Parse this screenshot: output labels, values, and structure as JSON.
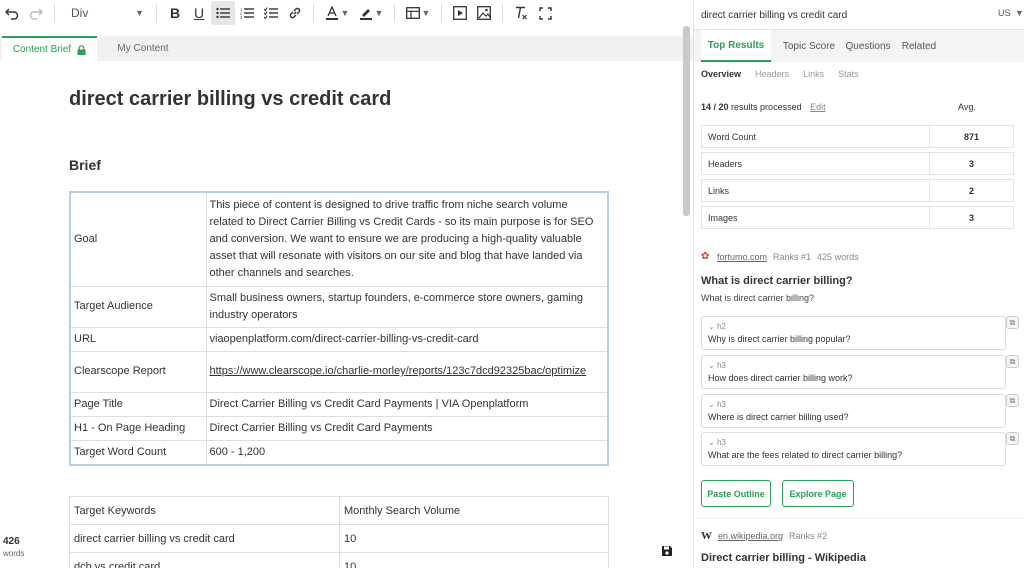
{
  "toolbar": {
    "block_type": "Div"
  },
  "editor": {
    "tabs": {
      "brief": "Content Brief",
      "content": "My Content"
    },
    "title": "direct carrier billing vs credit card",
    "brief_heading": "Brief",
    "brief_rows": [
      {
        "key": "Goal",
        "value": "This piece of content is designed to drive traffic from niche search volume related to Direct Carrier Billing vs Credit Cards - so its main purpose is for SEO and conversion. We want to ensure we are producing a high-quality valuable asset that will resonate with visitors on our site and blog that have landed via other channels and searches."
      },
      {
        "key": "Target Audience",
        "value": "Small business owners, startup founders, e-commerce store owners, gaming industry operators"
      },
      {
        "key": "URL",
        "value": "viaopenplatform.com/direct-carrier-billing-vs-credit-card"
      },
      {
        "key": "Clearscope Report",
        "value": "https://www.clearscope.io/charlie-morley/reports/123c7dcd92325bac/optimize"
      },
      {
        "key": "Page Title",
        "value": "Direct Carrier Billing vs Credit Card Payments | VIA Openplatform"
      },
      {
        "key": "H1 - On Page Heading",
        "value": "Direct Carrier Billing vs Credit Card Payments"
      },
      {
        "key": "Target Word Count",
        "value": "600 - 1,200"
      }
    ],
    "keywords": {
      "headers": [
        "Target Keywords",
        "Monthly Search Volume"
      ],
      "rows": [
        [
          "direct carrier billing vs credit card",
          "10"
        ],
        [
          "dcb vs credit card",
          "10"
        ]
      ]
    },
    "word_count": {
      "number": "426",
      "label": "words"
    }
  },
  "panel": {
    "search": {
      "value": "direct carrier billing vs credit card",
      "country": "US"
    },
    "tabs": [
      "Top Results",
      "Topic Score",
      "Questions",
      "Related"
    ],
    "subtabs": [
      "Overview",
      "Headers",
      "Links",
      "Stats"
    ],
    "processed": {
      "count": "14 / 20",
      "label": "results processed",
      "edit": "Edit"
    },
    "avg_label": "Avg.",
    "stats": [
      {
        "label": "Word Count",
        "value": "871"
      },
      {
        "label": "Headers",
        "value": "3"
      },
      {
        "label": "Links",
        "value": "2"
      },
      {
        "label": "Images",
        "value": "3"
      }
    ],
    "result1": {
      "domain": "fortumo.com",
      "rank": "Ranks #1",
      "words": "425 words",
      "title": "What is direct carrier billing?",
      "subtitle": "What is direct carrier billing?",
      "headings": [
        {
          "level": "h2",
          "text": "Why is direct carrier billing popular?"
        },
        {
          "level": "h3",
          "text": "How does direct carrier billing work?"
        },
        {
          "level": "h3",
          "text": "Where is direct carrier billing used?"
        },
        {
          "level": "h3",
          "text": "What are the fees related to direct carrier billing?"
        }
      ],
      "paste_label": "Paste Outline",
      "explore_label": "Explore Page"
    },
    "result2": {
      "domain": "en.wikipedia.org",
      "rank": "Ranks #2",
      "title": "Direct carrier billing - Wikipedia"
    }
  }
}
